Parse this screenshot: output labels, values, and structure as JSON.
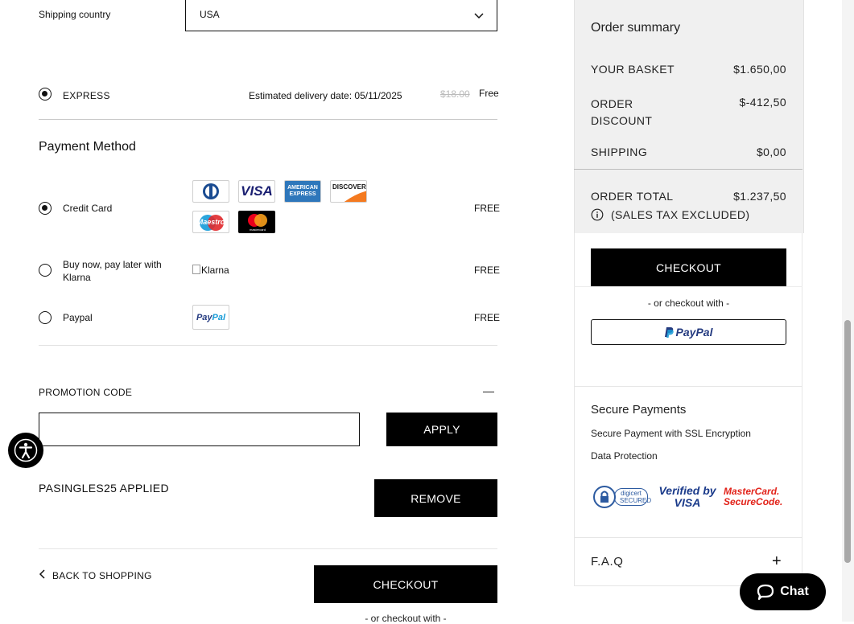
{
  "shipping": {
    "country_label": "Shipping country",
    "country_value": "USA",
    "method_name": "EXPRESS",
    "estimated_delivery": "Estimated delivery date: 05/11/2025",
    "old_price": "$18.00",
    "price": "Free"
  },
  "payment": {
    "title": "Payment Method",
    "options": [
      {
        "label": "Credit Card",
        "price": "FREE",
        "selected": true
      },
      {
        "label": "Buy now, pay later with Klarna",
        "price": "FREE",
        "selected": false,
        "logo_alt": "Klarna"
      },
      {
        "label": "Paypal",
        "price": "FREE",
        "selected": false
      }
    ],
    "cards": [
      "Diners",
      "VISA",
      "AMERICAN EXPRESS",
      "DISCOVER",
      "Maestro",
      "mastercard"
    ]
  },
  "promo": {
    "title": "PROMOTION CODE",
    "collapse_symbol": "—",
    "input_value": "",
    "apply_label": "APPLY",
    "applied_text": "PASINGLES25 APPLIED",
    "remove_label": "REMOVE"
  },
  "footer": {
    "back_label": "BACK TO SHOPPING",
    "checkout_label": "CHECKOUT",
    "or_checkout": "- or checkout with -"
  },
  "summary": {
    "title": "Order summary",
    "basket_label": "YOUR BASKET",
    "basket_value": "$1.650,00",
    "discount_label": "ORDER DISCOUNT",
    "discount_value": "$-412,50",
    "shipping_label": "SHIPPING",
    "shipping_value": "$0,00",
    "total_label": "ORDER TOTAL",
    "total_value": "$1.237,50",
    "tax_note": "(SALES TAX EXCLUDED)",
    "checkout_label": "CHECKOUT",
    "or_checkout": "- or checkout with -",
    "paypal_label": "PayPal"
  },
  "secure": {
    "title": "Secure Payments",
    "line1": "Secure Payment with SSL Encryption",
    "line2": "Data Protection",
    "badges": [
      "digicert SECURED",
      "Verified by VISA",
      "MasterCard. SecureCode."
    ]
  },
  "faq": {
    "label": "F.A.Q",
    "expand_symbol": "+"
  },
  "chat": {
    "label": "Chat"
  },
  "colors": {
    "black": "#000000",
    "summary_bg": "#f0f0f0",
    "paypal_dark": "#253b80",
    "paypal_light": "#179bd7"
  }
}
